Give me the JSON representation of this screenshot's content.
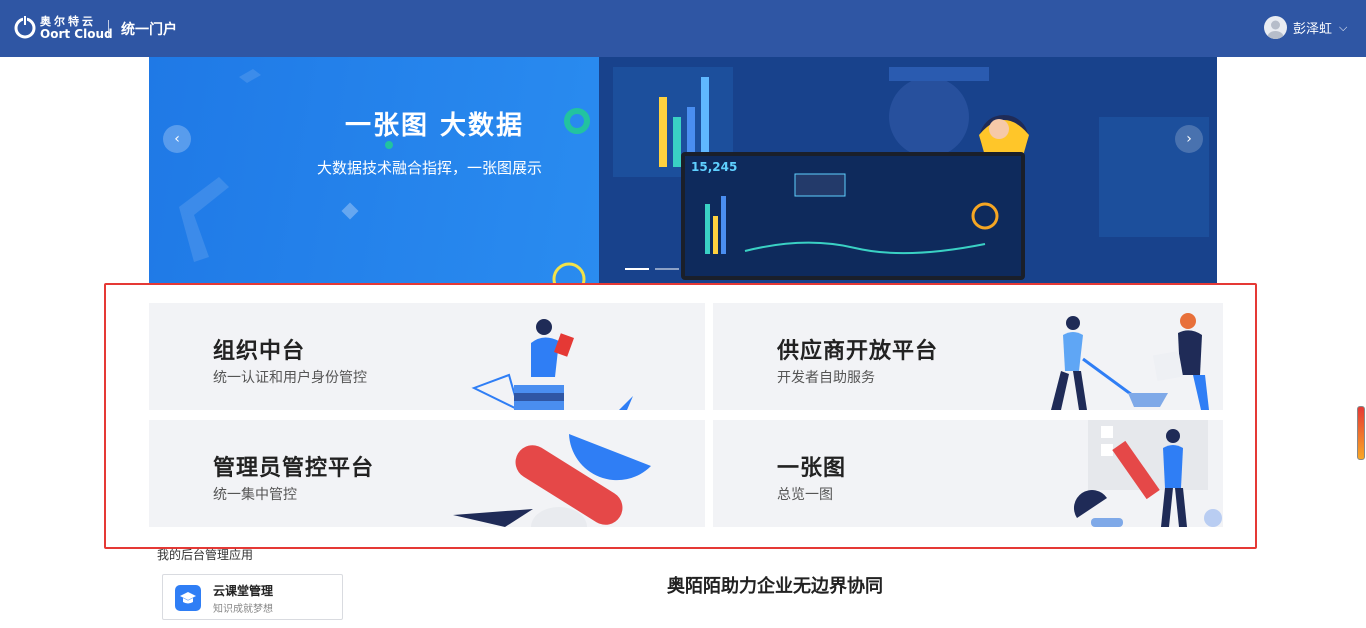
{
  "header": {
    "logo_cn": "奥尔特云",
    "logo_en": "Oort Cloud",
    "portal_title": "统一门户",
    "user_name": "彭泽虹"
  },
  "banner": {
    "title": "一张图  大数据",
    "subtitle": "大数据技术融合指挥，一张图展示",
    "screen_number": "15,245"
  },
  "modules": [
    {
      "title": "组织中台",
      "subtitle": "统一认证和用户身份管控"
    },
    {
      "title": "供应商开放平台",
      "subtitle": "开发者自助服务"
    },
    {
      "title": "管理员管控平台",
      "subtitle": "统一集中管控"
    },
    {
      "title": "一张图",
      "subtitle": "总览一图"
    }
  ],
  "my_apps": {
    "heading": "我的后台管理应用",
    "items": [
      {
        "name": "云课堂管理",
        "desc": "知识成就梦想"
      }
    ]
  },
  "slogan": "奥陌陌助力企业无边界协同",
  "colors": {
    "header_bg": "#2f56a4",
    "banner_bg": "#2a8cf0",
    "highlight_border": "#e53935",
    "card_bg": "#f2f3f6"
  }
}
